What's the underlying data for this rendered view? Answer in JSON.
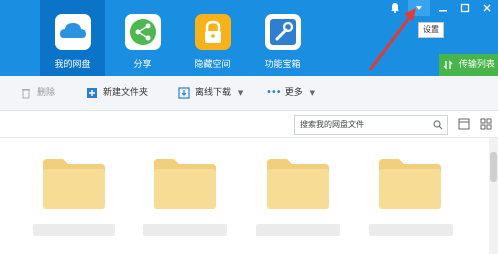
{
  "nav": {
    "items": [
      {
        "label": "我的网盘",
        "icon": "cloud-icon"
      },
      {
        "label": "分享",
        "icon": "share-icon"
      },
      {
        "label": "隐藏空间",
        "icon": "lock-icon"
      },
      {
        "label": "功能宝箱",
        "icon": "toolbox-icon"
      }
    ]
  },
  "window": {
    "tooltip": "设置",
    "transfer_label": "传输列表"
  },
  "toolbar": {
    "delete_label": "删除",
    "new_folder_label": "新建文件夹",
    "offline_download_label": "离线下载",
    "more_label": "更多"
  },
  "search": {
    "placeholder": "搜索我的网盘文件"
  },
  "colors": {
    "topbar": "#1a8ee0",
    "active_tab": "#0b73c8",
    "folder": "#f5d78a",
    "transfer_button": "#48b54a"
  }
}
